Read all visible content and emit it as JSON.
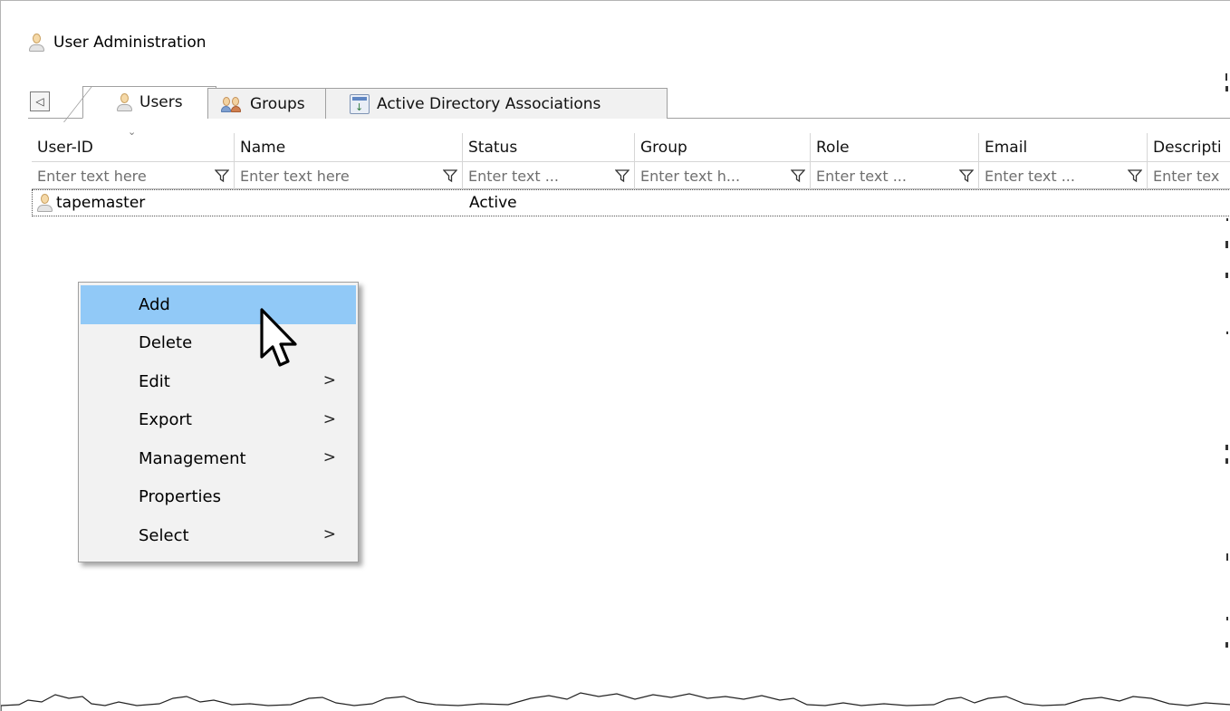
{
  "window": {
    "title": "User Administration"
  },
  "tabs": [
    {
      "label": "Users",
      "icon": "user-icon",
      "active": true
    },
    {
      "label": "Groups",
      "icon": "groups-icon",
      "active": false
    },
    {
      "label": "Active Directory Associations",
      "icon": "active-directory-icon",
      "active": false
    }
  ],
  "grid": {
    "columns": [
      {
        "key": "user_id",
        "label": "User-ID",
        "placeholder": "Enter text here"
      },
      {
        "key": "name",
        "label": "Name",
        "placeholder": "Enter text here"
      },
      {
        "key": "status",
        "label": "Status",
        "placeholder": "Enter text ..."
      },
      {
        "key": "group",
        "label": "Group",
        "placeholder": "Enter text h..."
      },
      {
        "key": "role",
        "label": "Role",
        "placeholder": "Enter text ..."
      },
      {
        "key": "email",
        "label": "Email",
        "placeholder": "Enter text ..."
      },
      {
        "key": "description",
        "label": "Descripti",
        "placeholder": "Enter tex"
      }
    ],
    "rows": [
      {
        "user_id": "tapemaster",
        "name": "",
        "status": "Active",
        "group": "",
        "role": "",
        "email": "",
        "description": ""
      }
    ]
  },
  "context_menu": {
    "items": [
      {
        "label": "Add",
        "submenu": false,
        "highlighted": true
      },
      {
        "label": "Delete",
        "submenu": false,
        "highlighted": false
      },
      {
        "label": "Edit",
        "submenu": true,
        "highlighted": false
      },
      {
        "label": "Export",
        "submenu": true,
        "highlighted": false
      },
      {
        "label": "Management",
        "submenu": true,
        "highlighted": false
      },
      {
        "label": "Properties",
        "submenu": false,
        "highlighted": false
      },
      {
        "label": "Select",
        "submenu": true,
        "highlighted": false
      }
    ],
    "submenu_arrow": ">"
  },
  "colors": {
    "menu_highlight": "#91c9f7",
    "menu_background": "#f2f2f2",
    "placeholder_text": "#6f6f6f"
  }
}
